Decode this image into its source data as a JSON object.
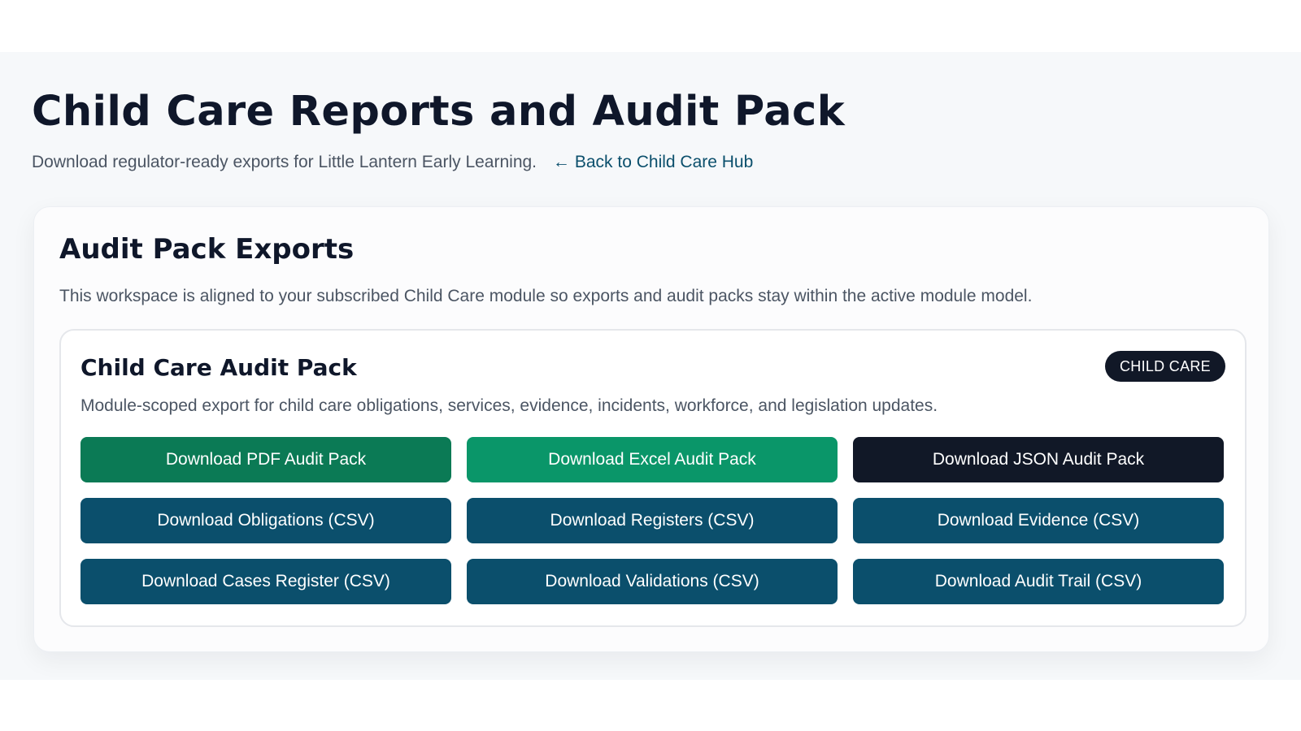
{
  "header": {
    "title": "Child Care Reports and Audit Pack",
    "subtitle": "Download regulator-ready exports for Little Lantern Early Learning.",
    "back_link_arrow": "←",
    "back_link_label": "Back to Child Care Hub"
  },
  "exports_card": {
    "title": "Audit Pack Exports",
    "description": "This workspace is aligned to your subscribed Child Care module so exports and audit packs stay within the active module model.",
    "audit_pack": {
      "title": "Child Care Audit Pack",
      "badge": "CHILD CARE",
      "description": "Module-scoped export for child care obligations, services, evidence, incidents, workforce, and legislation updates.",
      "buttons": [
        {
          "label": "Download PDF Audit Pack",
          "color": "#0b7a55"
        },
        {
          "label": "Download Excel Audit Pack",
          "color": "#0a9669"
        },
        {
          "label": "Download JSON Audit Pack",
          "color": "#111827"
        },
        {
          "label": "Download Obligations (CSV)",
          "color": "#0b4f6c"
        },
        {
          "label": "Download Registers (CSV)",
          "color": "#0b4f6c"
        },
        {
          "label": "Download Evidence (CSV)",
          "color": "#0b4f6c"
        },
        {
          "label": "Download Cases Register (CSV)",
          "color": "#0b4f6c"
        },
        {
          "label": "Download Validations (CSV)",
          "color": "#0b4f6c"
        },
        {
          "label": "Download Audit Trail (CSV)",
          "color": "#0b4f6c"
        }
      ]
    }
  },
  "colors": {
    "link": "#0b4f6c",
    "badge_bg": "#111827",
    "page_bg": "#f6f8fa"
  }
}
